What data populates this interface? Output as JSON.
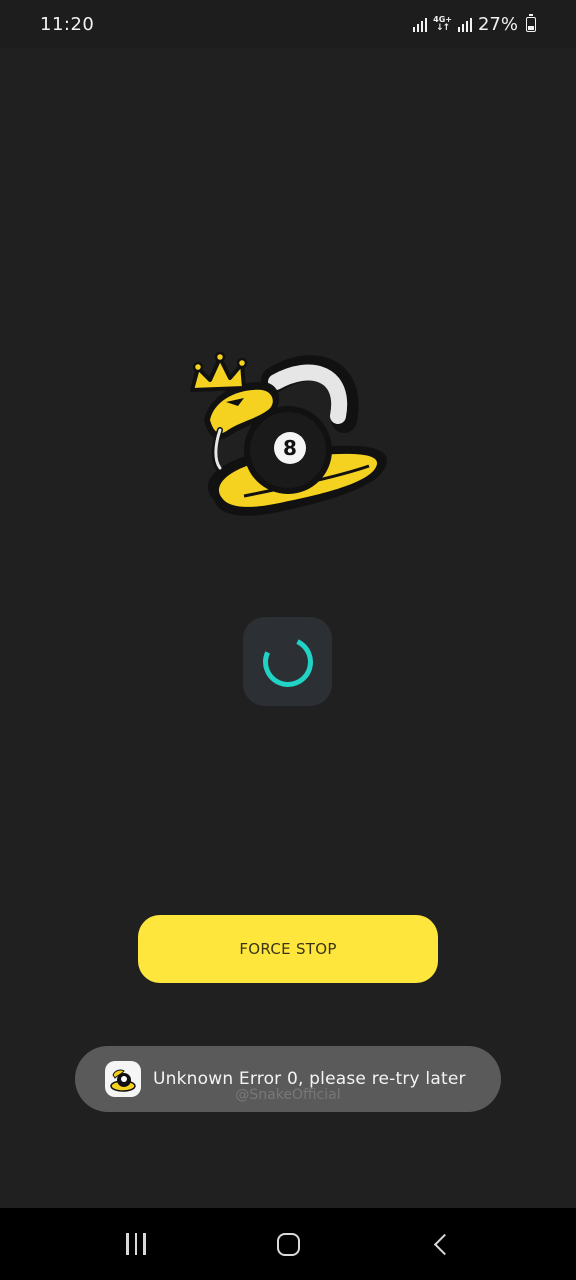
{
  "status_bar": {
    "time": "11:20",
    "network": "4G+",
    "battery": "27%"
  },
  "logo": {
    "icon": "snake-8ball-crown-logo",
    "ball_number": "8",
    "colors": {
      "gold": "#f4d21f",
      "dark": "#111111"
    }
  },
  "loader": {
    "icon": "loading-spinner-icon",
    "color": "#20d3c4"
  },
  "force_stop": {
    "label": "FORCE STOP",
    "color": "#ffe63d"
  },
  "toast": {
    "icon": "app-icon",
    "message": "Unknown Error 0, please re-try later"
  },
  "watermark": {
    "text": "@SnakeOfficial"
  },
  "nav_bar": {
    "recents": "recents-icon",
    "home": "home-icon",
    "back": "back-icon"
  }
}
